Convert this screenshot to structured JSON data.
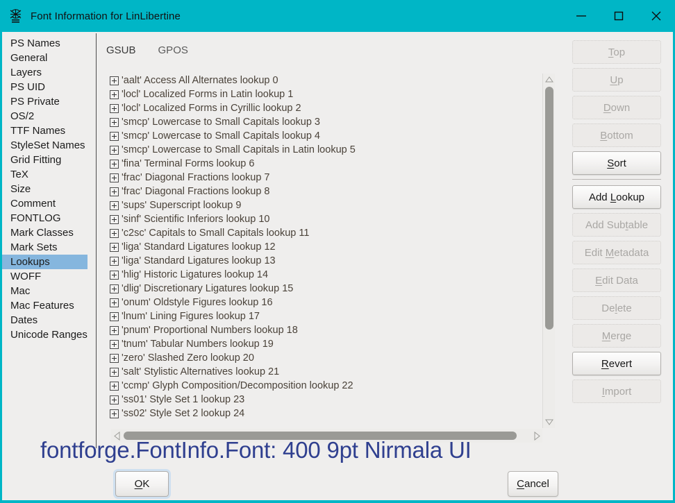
{
  "window": {
    "title": "Font Information for LinLibertine",
    "icon": "fontforge-icon",
    "titlebar_color": "#00b6c6",
    "controls": [
      {
        "name": "minimize-button",
        "glyph": "minimize"
      },
      {
        "name": "maximize-button",
        "glyph": "maximize"
      },
      {
        "name": "close-button",
        "glyph": "close"
      }
    ]
  },
  "sidebar": {
    "selected": "Lookups",
    "selection_color": "#85b6de",
    "items": [
      {
        "label": "PS Names"
      },
      {
        "label": "General"
      },
      {
        "label": "Layers"
      },
      {
        "label": "PS UID"
      },
      {
        "label": "PS Private"
      },
      {
        "label": "OS/2"
      },
      {
        "label": "TTF Names"
      },
      {
        "label": "StyleSet Names"
      },
      {
        "label": "Grid Fitting"
      },
      {
        "label": "TeX"
      },
      {
        "label": "Size"
      },
      {
        "label": "Comment"
      },
      {
        "label": "FONTLOG"
      },
      {
        "label": "Mark Classes"
      },
      {
        "label": "Mark Sets"
      },
      {
        "label": "Lookups"
      },
      {
        "label": "WOFF"
      },
      {
        "label": "Mac"
      },
      {
        "label": "Mac Features"
      },
      {
        "label": "Dates"
      },
      {
        "label": "Unicode Ranges"
      }
    ]
  },
  "tabs": [
    {
      "label": "GSUB",
      "active": true
    },
    {
      "label": "GPOS",
      "active": false
    }
  ],
  "lookups": [
    "'aalt' Access All Alternates lookup 0",
    "'locl' Localized Forms in Latin lookup 1",
    "'locl' Localized Forms in Cyrillic lookup 2",
    "'smcp' Lowercase to Small Capitals lookup 3",
    "'smcp' Lowercase to Small Capitals lookup 4",
    "'smcp' Lowercase to Small Capitals in Latin lookup 5",
    "'fina' Terminal Forms lookup 6",
    "'frac' Diagonal Fractions lookup 7",
    "'frac' Diagonal Fractions lookup 8",
    "'sups' Superscript lookup 9",
    "'sinf' Scientific Inferiors lookup 10",
    "'c2sc' Capitals to Small Capitals lookup 11",
    "'liga' Standard Ligatures lookup 12",
    "'liga' Standard Ligatures lookup 13",
    "'hlig' Historic Ligatures lookup 14",
    "'dlig' Discretionary Ligatures lookup 15",
    "'onum' Oldstyle Figures lookup 16",
    "'lnum' Lining Figures lookup 17",
    "'pnum' Proportional Numbers lookup 18",
    "'tnum' Tabular Numbers lookup 19",
    "'zero' Slashed Zero lookup 20",
    "'salt' Stylistic Alternatives lookup 21",
    "'ccmp' Glyph Composition/Decomposition lookup 22",
    "'ss01' Style Set 1 lookup 23",
    "'ss02' Style Set 2 lookup 24"
  ],
  "side_buttons": [
    {
      "label": "Top",
      "mnemonic": "T",
      "enabled": false
    },
    {
      "label": "Up",
      "mnemonic": "U",
      "enabled": false
    },
    {
      "label": "Down",
      "mnemonic": "D",
      "enabled": false
    },
    {
      "label": "Bottom",
      "mnemonic": "B",
      "enabled": false
    },
    {
      "label": "Sort",
      "mnemonic": "S",
      "enabled": true
    },
    {
      "label": "Add Lookup",
      "mnemonic": "L",
      "enabled": true
    },
    {
      "label": "Add Subtable",
      "mnemonic": "t",
      "enabled": false
    },
    {
      "label": "Edit Metadata",
      "mnemonic": "M",
      "enabled": false
    },
    {
      "label": "Edit Data",
      "mnemonic": "E",
      "enabled": false
    },
    {
      "label": "Delete",
      "mnemonic": "l",
      "enabled": false
    },
    {
      "label": "Merge",
      "mnemonic": "M",
      "enabled": false
    },
    {
      "label": "Revert",
      "mnemonic": "R",
      "enabled": true
    },
    {
      "label": "Import",
      "mnemonic": "I",
      "enabled": false
    }
  ],
  "overlay": {
    "text": "fontforge.FontInfo.Font: 400 9pt Nirmala UI",
    "color": "#2f3f8f"
  },
  "footer": {
    "ok_label": "OK",
    "ok_mnemonic": "O",
    "cancel_label": "Cancel",
    "cancel_mnemonic": "C"
  },
  "scrollbars": {
    "vertical_thumb_percent": 68,
    "horizontal_thumb_percent": 91
  }
}
